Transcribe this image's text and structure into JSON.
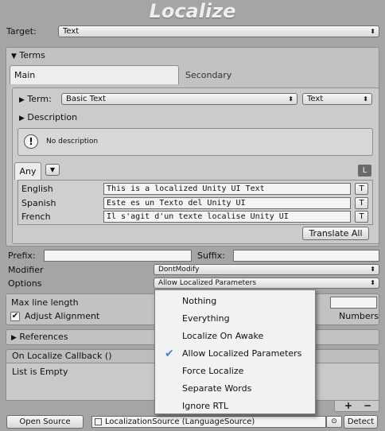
{
  "title": "Localize",
  "target": {
    "label": "Target:",
    "value": "Text"
  },
  "terms": {
    "header": "Terms",
    "tabs": {
      "main": "Main",
      "secondary": "Secondary"
    },
    "term_label": "Term:",
    "term_value": "Basic Text",
    "term_type": "Text",
    "description_label": "Description",
    "no_description": "No description",
    "filter_any": "Any",
    "lang_button": "L",
    "translations": [
      {
        "language": "English",
        "text": "This is a localized Unity UI Text",
        "button": "T"
      },
      {
        "language": "Spanish",
        "text": "Este es un Texto del Unity UI",
        "button": "T"
      },
      {
        "language": "French",
        "text": "Il s'agit d'un texte localise Unity UI",
        "button": "T"
      }
    ],
    "translate_all": "Translate All"
  },
  "prefix_label": "Prefix:",
  "prefix_value": "",
  "suffix_label": "Suffix:",
  "suffix_value": "",
  "modifier": {
    "label": "Modifier",
    "value": "DontModify"
  },
  "options": {
    "label": "Options",
    "value": "Allow Localized Parameters"
  },
  "max_line_length_label": "Max line length",
  "adjust_alignment": {
    "label": "Adjust Alignment",
    "checked": true
  },
  "numbers_tail": "Numbers",
  "references_label": "References",
  "callback": {
    "header": "On Localize Callback ()",
    "empty": "List is Empty",
    "add": "+",
    "remove": "−"
  },
  "footer": {
    "open_source": "Open Source",
    "source_value": "LocalizationSource (LanguageSource)",
    "target_dot": "⊙",
    "detect": "Detect"
  },
  "options_menu": {
    "items": [
      {
        "label": "Nothing",
        "checked": false
      },
      {
        "label": "Everything",
        "checked": false
      },
      {
        "label": "Localize On Awake",
        "checked": false
      },
      {
        "label": "Allow Localized Parameters",
        "checked": true
      },
      {
        "label": "Force Localize",
        "checked": false
      },
      {
        "label": "Separate Words",
        "checked": false
      },
      {
        "label": "Ignore RTL",
        "checked": false
      }
    ]
  }
}
